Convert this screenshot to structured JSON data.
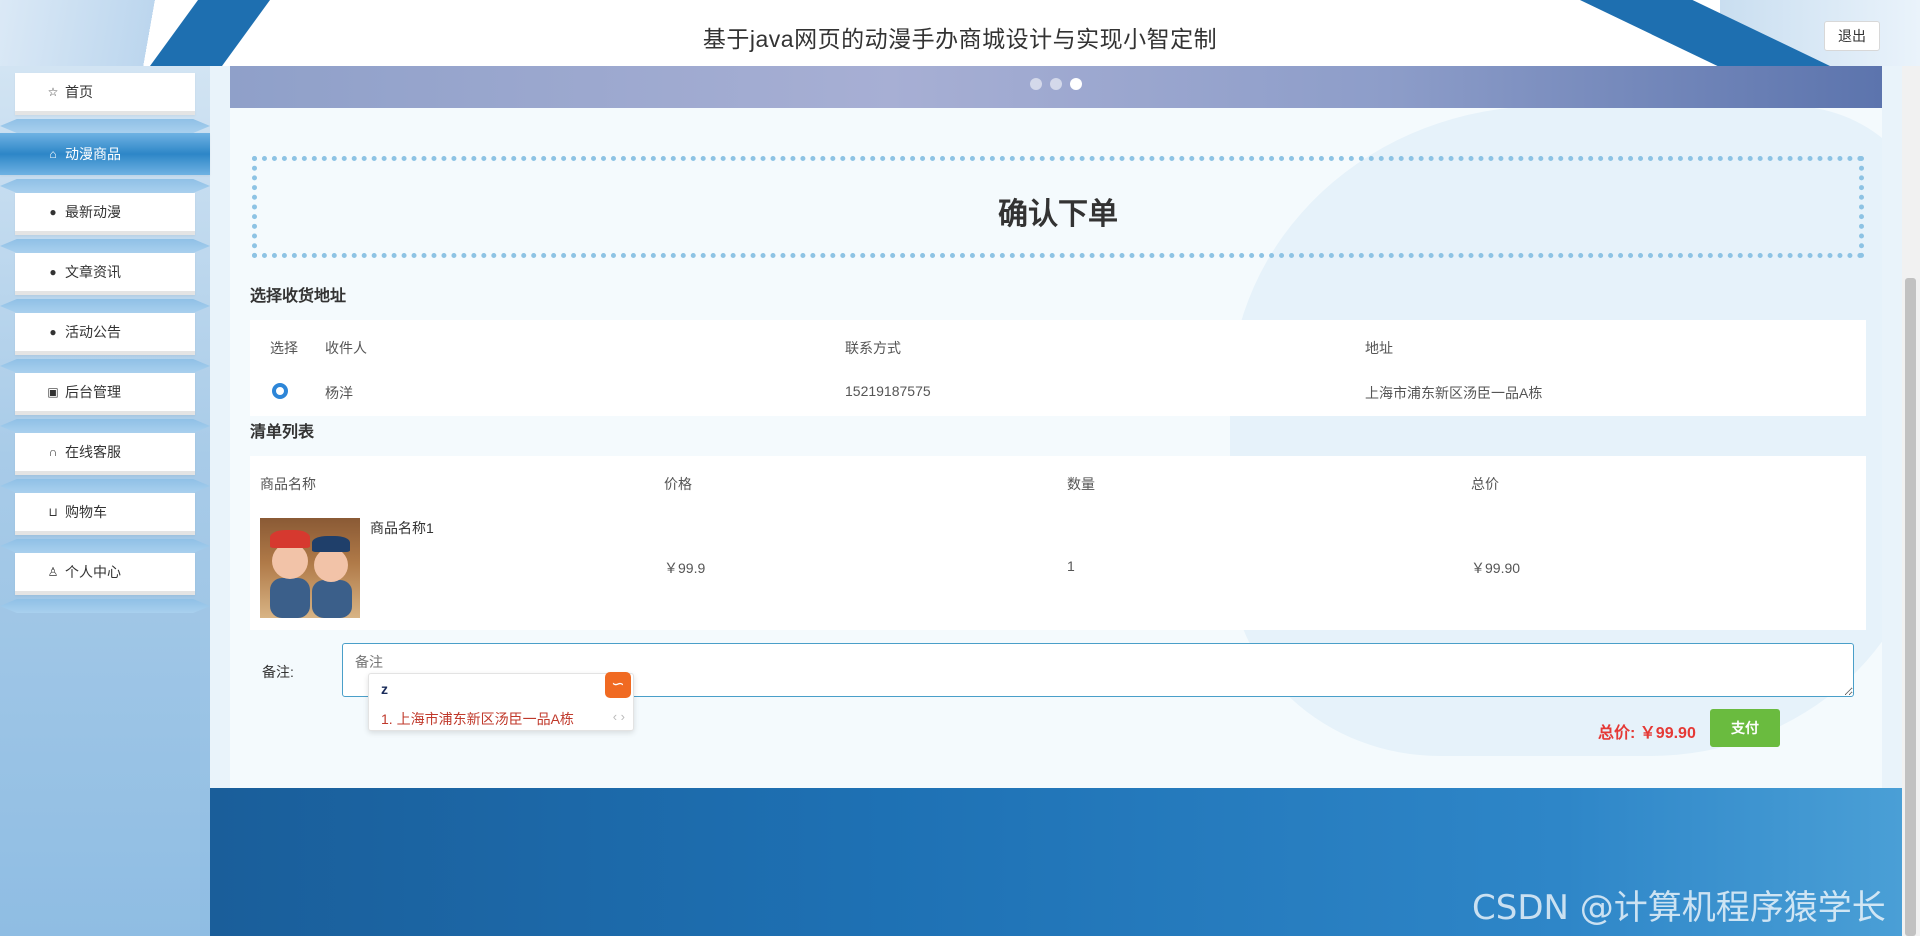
{
  "header": {
    "title": "基于java网页的动漫手办商城设计与实现小智定制",
    "logout_label": "退出"
  },
  "sidebar": {
    "items": [
      {
        "label": "首页",
        "icon": "star-icon"
      },
      {
        "label": "动漫商品",
        "icon": "bag-icon",
        "active": true
      },
      {
        "label": "最新动漫",
        "icon": "alert-icon"
      },
      {
        "label": "文章资讯",
        "icon": "question-icon"
      },
      {
        "label": "活动公告",
        "icon": "info-icon"
      },
      {
        "label": "后台管理",
        "icon": "briefcase-icon"
      },
      {
        "label": "在线客服",
        "icon": "headset-icon"
      },
      {
        "label": "购物车",
        "icon": "cart-icon"
      },
      {
        "label": "个人中心",
        "icon": "user-icon"
      }
    ]
  },
  "banner": {
    "dot_count": 3,
    "active_dot_index": 2
  },
  "order": {
    "title": "确认下单"
  },
  "address": {
    "section_title": "选择收货地址",
    "headers": {
      "select": "选择",
      "receiver": "收件人",
      "phone": "联系方式",
      "address": "地址"
    },
    "rows": [
      {
        "selected": true,
        "receiver": "杨洋",
        "phone": "15219187575",
        "address": "上海市浦东新区汤臣一品A栋"
      }
    ]
  },
  "list": {
    "section_title": "清单列表",
    "headers": {
      "name": "商品名称",
      "price": "价格",
      "quantity": "数量",
      "total": "总价"
    },
    "rows": [
      {
        "name": "商品名称1",
        "price": "￥99.9",
        "quantity": "1",
        "total": "￥99.90"
      }
    ]
  },
  "remark": {
    "label": "备注:",
    "placeholder": "备注",
    "value": ""
  },
  "ime": {
    "composing": "z",
    "candidate": "1. 上海市浦东新区汤臣一品A栋",
    "arrows": "‹ ›"
  },
  "summary": {
    "total_label": "总价:",
    "total_value": "￥99.90",
    "pay_label": "支付"
  },
  "watermark": "CSDN @计算机程序猿学长",
  "colors": {
    "accent": "#2d86c7",
    "total_red": "#e53935",
    "pay_green": "#6abb3f",
    "footer_blue": "#1e71b4"
  }
}
